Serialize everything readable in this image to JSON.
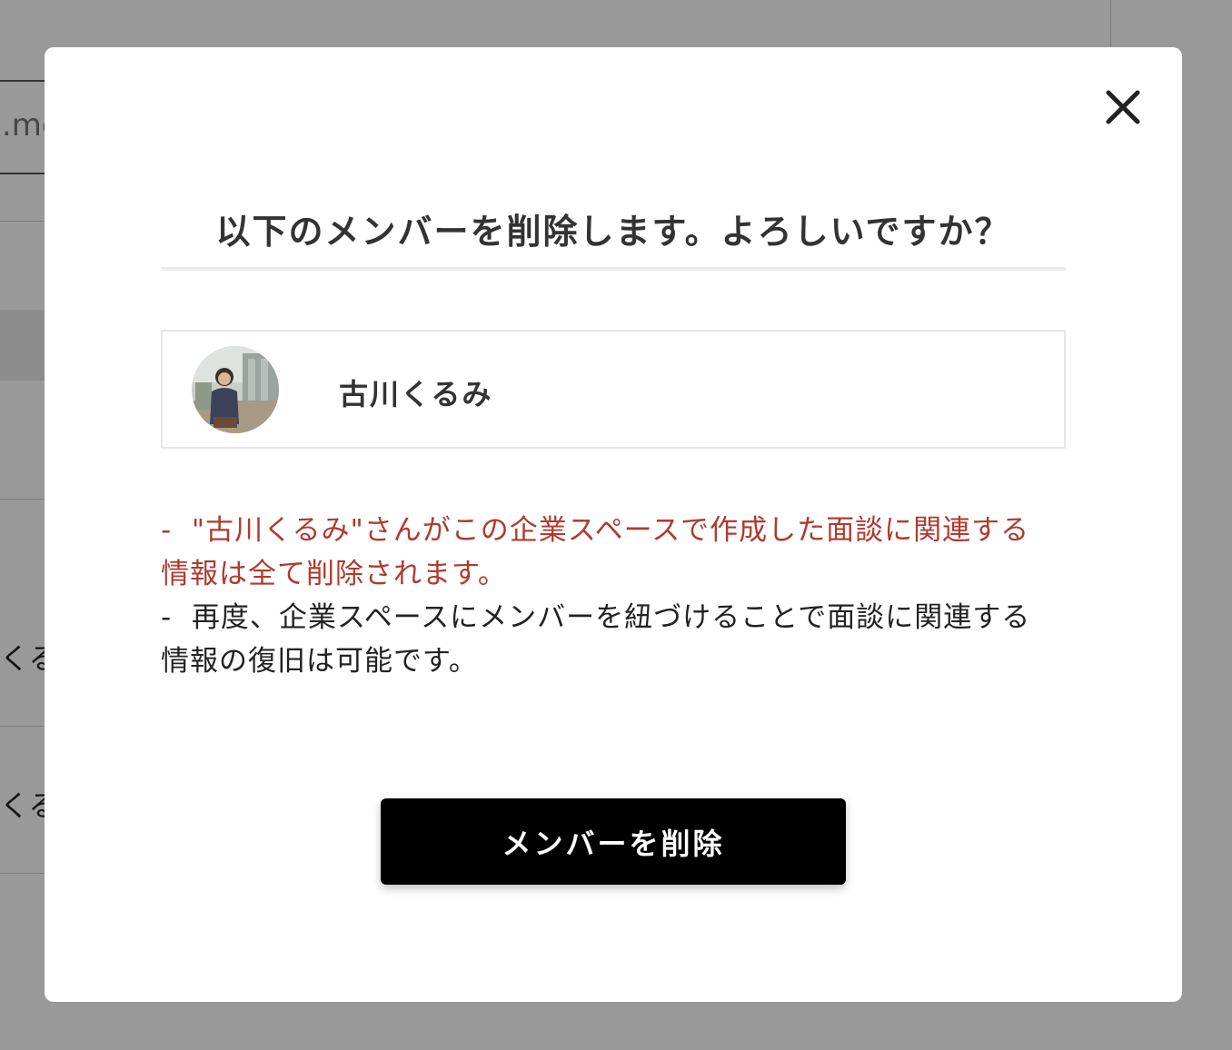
{
  "background": {
    "input_fragment": ".me",
    "rows": [
      {
        "text_fragment": "くる"
      },
      {
        "text_fragment": "くる"
      }
    ]
  },
  "modal": {
    "close_icon": "close-icon",
    "title": "以下のメンバーを削除します。よろしいですか？",
    "member": {
      "name": "古川くるみ",
      "avatar_icon": "avatar-photo"
    },
    "notes": {
      "warning_line1": "-  \"古川くるみ\"さんがこの企業スペースで作成した面談に関連する",
      "warning_line2": "情報は全て削除されます。",
      "info_line1": "-  再度、企業スペースにメンバーを紐づけることで面談に関連する",
      "info_line2": "情報の復旧は可能です。"
    },
    "delete_button_label": "メンバーを削除"
  },
  "colors": {
    "warning_text": "#b03a2e",
    "button_bg": "#000000",
    "overlay": "rgba(0,0,0,0.4)"
  }
}
